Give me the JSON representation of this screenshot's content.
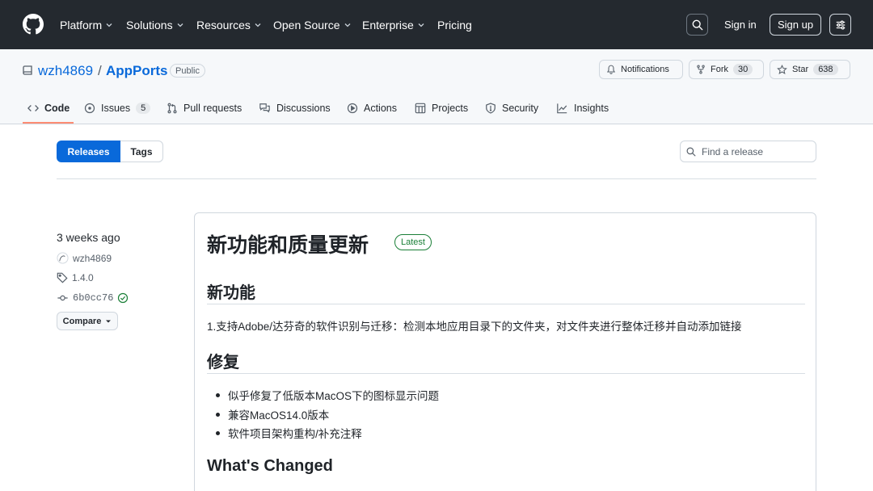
{
  "nav": {
    "items": [
      {
        "label": "Platform",
        "dropdown": true
      },
      {
        "label": "Solutions",
        "dropdown": true
      },
      {
        "label": "Resources",
        "dropdown": true
      },
      {
        "label": "Open Source",
        "dropdown": true
      },
      {
        "label": "Enterprise",
        "dropdown": true
      },
      {
        "label": "Pricing",
        "dropdown": false
      }
    ],
    "sign_in": "Sign in",
    "sign_up": "Sign up"
  },
  "repo": {
    "owner": "wzh4869",
    "separator": "/",
    "name": "AppPorts",
    "visibility": "Public",
    "notifications_label": "Notifications",
    "fork_label": "Fork",
    "fork_count": "30",
    "star_label": "Star",
    "star_count": "638"
  },
  "tabs": [
    {
      "label": "Code",
      "active": true
    },
    {
      "label": "Issues",
      "count": "5"
    },
    {
      "label": "Pull requests"
    },
    {
      "label": "Discussions"
    },
    {
      "label": "Actions"
    },
    {
      "label": "Projects"
    },
    {
      "label": "Security"
    },
    {
      "label": "Insights"
    }
  ],
  "toolbar": {
    "releases_label": "Releases",
    "tags_label": "Tags",
    "find_placeholder": "Find a release"
  },
  "release": {
    "date": "3 weeks ago",
    "author": "wzh4869",
    "tag": "1.4.0",
    "commit": "6b0cc76",
    "compare_label": "Compare",
    "title": "新功能和质量更新",
    "latest_label": "Latest",
    "section1_heading": "新功能",
    "section1_text": "1.支持Adobe/达芬奇的软件识别与迁移：检测本地应用目录下的文件夹，对文件夹进行整体迁移并自动添加链接",
    "section2_heading": "修复",
    "fixes": [
      "似乎修复了低版本MacOS下的图标显示问题",
      "兼容MacOS14.0版本",
      "软件项目架构重构/补充注释"
    ],
    "section3_heading": "What's Changed"
  },
  "colors": {
    "header_bg": "#24292f",
    "link": "#0969da",
    "primary_button": "#0969da",
    "latest_green": "#1a7f37",
    "tab_underline": "#fd8c73"
  }
}
